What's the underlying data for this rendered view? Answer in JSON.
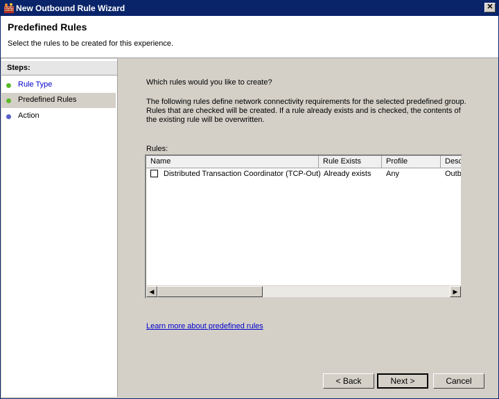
{
  "window": {
    "title": "New Outbound Rule Wizard",
    "close_glyph": "✕"
  },
  "header": {
    "title": "Predefined Rules",
    "subtitle": "Select the rules to be created for this experience."
  },
  "steps": {
    "heading": "Steps:",
    "items": [
      {
        "label": "Rule Type",
        "status": "done",
        "color": "#5cb82a"
      },
      {
        "label": "Predefined Rules",
        "status": "current",
        "color": "#5cb82a"
      },
      {
        "label": "Action",
        "status": "pending",
        "color": "#5860c8"
      }
    ]
  },
  "content": {
    "question": "Which rules would you like to create?",
    "description": "The following rules define network connectivity requirements for the selected predefined group. Rules that are checked will be created. If a rule already exists and is checked, the contents of the existing rule will be overwritten.",
    "rules_label": "Rules:",
    "columns": [
      "Name",
      "Rule Exists",
      "Profile",
      "Desc"
    ],
    "rows": [
      {
        "checked": false,
        "name": "Distributed Transaction Coordinator (TCP-Out)",
        "exists": "Already exists",
        "profile": "Any",
        "desc": "Outb"
      }
    ],
    "scroll_left_glyph": "◀",
    "scroll_right_glyph": "▶",
    "link": "Learn more about predefined rules"
  },
  "buttons": {
    "back": "< Back",
    "next": "Next >",
    "cancel": "Cancel"
  }
}
